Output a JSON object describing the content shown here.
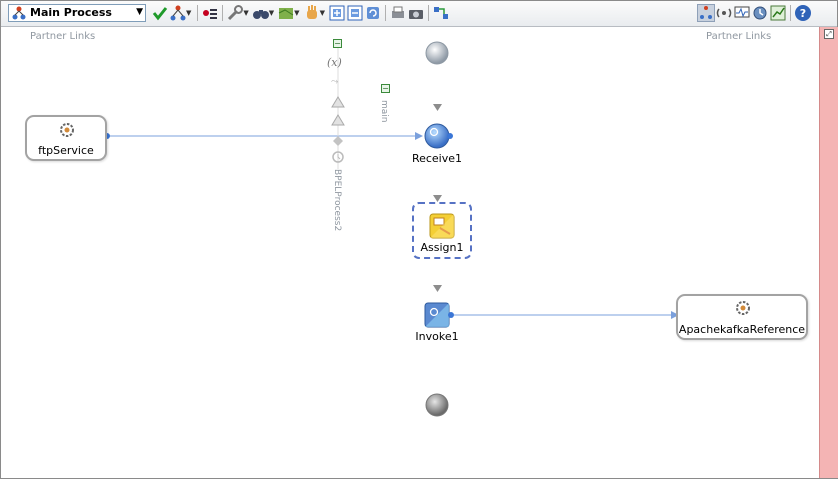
{
  "toolbar": {
    "process_selector": {
      "value": "Main Process"
    },
    "buttons": [
      {
        "id": "validate",
        "icon": "checkmark-icon"
      },
      {
        "id": "flow",
        "icon": "flow-icon"
      },
      {
        "id": "toggle",
        "icon": "toggle-icon"
      },
      {
        "id": "wrench",
        "icon": "wrench-icon"
      },
      {
        "id": "binoculars",
        "icon": "binoculars-icon"
      },
      {
        "id": "map",
        "icon": "map-icon"
      },
      {
        "id": "hand",
        "icon": "hand-icon"
      },
      {
        "id": "expand",
        "icon": "expand-icon"
      },
      {
        "id": "collapse",
        "icon": "collapse-icon"
      },
      {
        "id": "refresh",
        "icon": "refresh-icon"
      },
      {
        "id": "print",
        "icon": "print-icon"
      },
      {
        "id": "camera",
        "icon": "camera-icon"
      },
      {
        "id": "partner",
        "icon": "partner-link-icon"
      },
      {
        "id": "design",
        "icon": "design-view-icon"
      },
      {
        "id": "signal",
        "icon": "signal-icon"
      },
      {
        "id": "monitor",
        "icon": "monitor-icon"
      },
      {
        "id": "sensor",
        "icon": "sensor-icon"
      },
      {
        "id": "chart",
        "icon": "chart-icon"
      },
      {
        "id": "help",
        "icon": "help-icon"
      }
    ]
  },
  "canvas": {
    "partner_links_left": "Partner Links",
    "partner_links_right": "Partner Links",
    "scope_main": "main",
    "process_name": "BPELProcess2",
    "variables_symbol": "(x)",
    "services": {
      "left": "ftpService",
      "right": "ApachekafkaReference"
    },
    "activities": {
      "receive": "Receive1",
      "assign": "Assign1",
      "invoke": "Invoke1"
    }
  },
  "colors": {
    "accent_pink": "#f4b4b4",
    "link_blue": "#7ba0dc",
    "selection_blue": "#5672c4"
  }
}
